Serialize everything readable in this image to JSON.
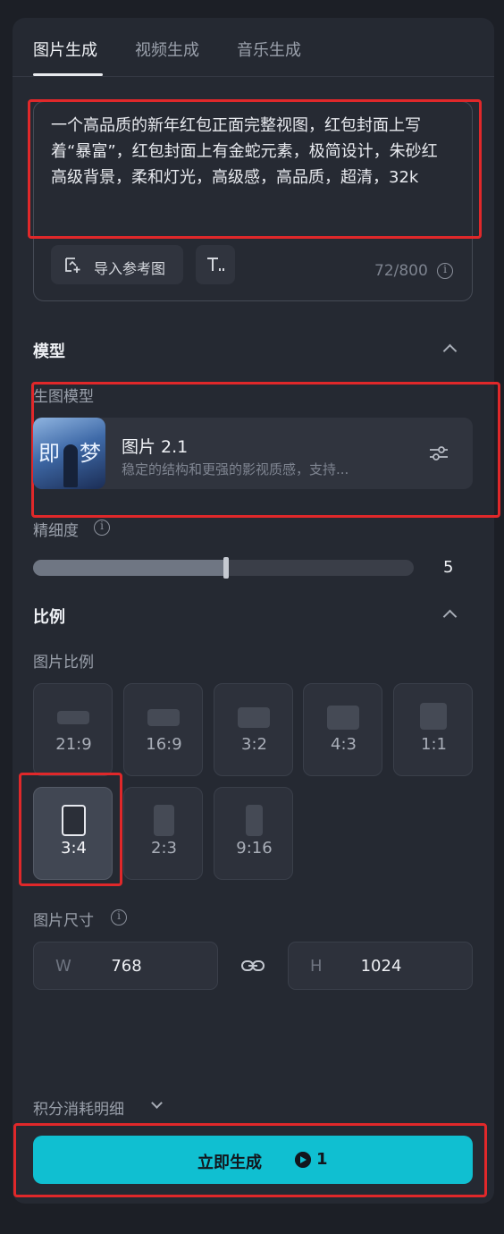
{
  "tabs": [
    {
      "label": "图片生成",
      "active": true
    },
    {
      "label": "视频生成",
      "active": false
    },
    {
      "label": "音乐生成",
      "active": false
    }
  ],
  "prompt": {
    "text": "一个高品质的新年红包正面完整视图，红包封面上写着“暴富”，红包封面上有金蛇元素，极简设计，朱砂红高级背景，柔和灯光，高级感，高品质，超清，32k",
    "import_ref_label": "导入参考图",
    "counter": "72/800"
  },
  "model_section": {
    "title": "模型",
    "sub_label": "生图模型",
    "model_name": "图片 2.1",
    "model_desc": "稳定的结构和更强的影视质感，支持...",
    "thumb_text": [
      "即",
      "梦"
    ]
  },
  "detail": {
    "label": "精细度",
    "value": "5",
    "level_fraction": 0.5
  },
  "ratio_section": {
    "title": "比例",
    "sub_label": "图片比例",
    "options": [
      {
        "label": "21:9",
        "selected": false
      },
      {
        "label": "16:9",
        "selected": false
      },
      {
        "label": "3:2",
        "selected": false
      },
      {
        "label": "4:3",
        "selected": false
      },
      {
        "label": "1:1",
        "selected": false
      },
      {
        "label": "3:4",
        "selected": true
      },
      {
        "label": "2:3",
        "selected": false
      },
      {
        "label": "9:16",
        "selected": false
      }
    ]
  },
  "size_section": {
    "label": "图片尺寸",
    "width_prefix": "W",
    "width": "768",
    "height_prefix": "H",
    "height": "1024"
  },
  "footer": {
    "credits_label": "积分消耗明细",
    "generate_label": "立即生成",
    "generate_cost": "1"
  },
  "colors": {
    "accent": "#10bfd1",
    "annotation_red": "#e0282a",
    "panel_bg": "#252932"
  }
}
